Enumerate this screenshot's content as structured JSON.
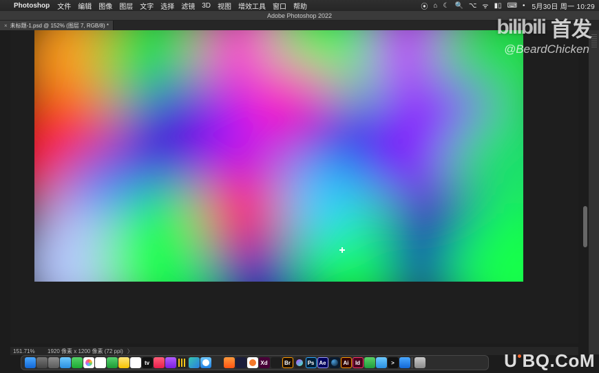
{
  "menubar": {
    "app_name": "Photoshop",
    "items": [
      "文件",
      "编辑",
      "图像",
      "图层",
      "文字",
      "选择",
      "滤镜",
      "3D",
      "视图",
      "增效工具",
      "窗口",
      "帮助"
    ],
    "right_icons": [
      "record-icon",
      "home-icon",
      "moon-icon",
      "spotlight-icon",
      "control-center-icon",
      "wifi-icon",
      "battery-icon",
      "input-source-icon",
      "video-icon"
    ],
    "clock": "5月30日 周一  10:29"
  },
  "window": {
    "title": "Adobe Photoshop 2022",
    "tab_label": "未标题-1.psd @ 152% (图层 7, RGB/8) *"
  },
  "status": {
    "zoom": "151.71%",
    "doc_info": "1920 像素 x 1200 像素 (72 ppi)"
  },
  "calendar_day": "30",
  "dock_icons": [
    {
      "name": "finder-icon",
      "cls": "finder",
      "label": ""
    },
    {
      "name": "launchpad-icon",
      "cls": "lpad",
      "label": ""
    },
    {
      "name": "system-settings-icon",
      "cls": "sysset",
      "label": ""
    },
    {
      "name": "icloud-icon",
      "cls": "icloud",
      "label": ""
    },
    {
      "name": "messages-icon",
      "cls": "msg",
      "label": ""
    },
    {
      "name": "photos-icon",
      "cls": "photos",
      "label": ""
    },
    {
      "name": "calendar-icon",
      "cls": "cal",
      "label": "30"
    },
    {
      "name": "wechat-icon",
      "cls": "wechat",
      "label": ""
    },
    {
      "name": "notes-icon",
      "cls": "notes",
      "label": ""
    },
    {
      "name": "reminders-icon",
      "cls": "rem",
      "label": ""
    },
    {
      "name": "appletv-icon",
      "cls": "tv",
      "label": "tv"
    },
    {
      "name": "music-icon",
      "cls": "music",
      "label": ""
    },
    {
      "name": "podcasts-icon",
      "cls": "pod",
      "label": ""
    },
    {
      "name": "clips-icon",
      "cls": "clips",
      "label": ""
    },
    {
      "name": "edge-icon",
      "cls": "edge",
      "label": ""
    },
    {
      "name": "safari-icon",
      "cls": "safari",
      "label": ""
    },
    {
      "name": "clipstudio-icon",
      "cls": "csp",
      "label": ""
    },
    {
      "name": "qq-icon",
      "cls": "qq",
      "label": ""
    },
    {
      "name": "cinema4d-icon",
      "cls": "c4d",
      "label": ""
    },
    {
      "name": "blender-icon",
      "cls": "blender",
      "label": ""
    },
    {
      "name": "xd-icon",
      "cls": "xd",
      "label": "Xd"
    },
    {
      "name": "figma-icon",
      "cls": "figma",
      "label": ""
    },
    {
      "name": "bridge-icon",
      "cls": "br",
      "label": "Br"
    },
    {
      "name": "pureref-icon",
      "cls": "pureref",
      "label": ""
    },
    {
      "name": "photoshop-icon",
      "cls": "ps",
      "label": "Ps"
    },
    {
      "name": "aftereffects-icon",
      "cls": "ae",
      "label": "Ae"
    },
    {
      "name": "steam-icon",
      "cls": "steam",
      "label": ""
    },
    {
      "name": "illustrator-icon",
      "cls": "ai",
      "label": "Ai"
    },
    {
      "name": "indesign-icon",
      "cls": "id",
      "label": "Id"
    },
    {
      "name": "numbers-icon",
      "cls": "numbers",
      "label": ""
    },
    {
      "name": "folder-icon",
      "cls": "folder",
      "label": ""
    },
    {
      "name": "terminal-icon",
      "cls": "term",
      "label": ">"
    },
    {
      "name": "appstore-icon",
      "cls": "astore",
      "label": ""
    }
  ],
  "overlay": {
    "bilibili_logo": "bilibili",
    "bilibili_tag": "首发",
    "handle": "@BeardChicken",
    "site_watermark": "UiBQ.CoM"
  }
}
